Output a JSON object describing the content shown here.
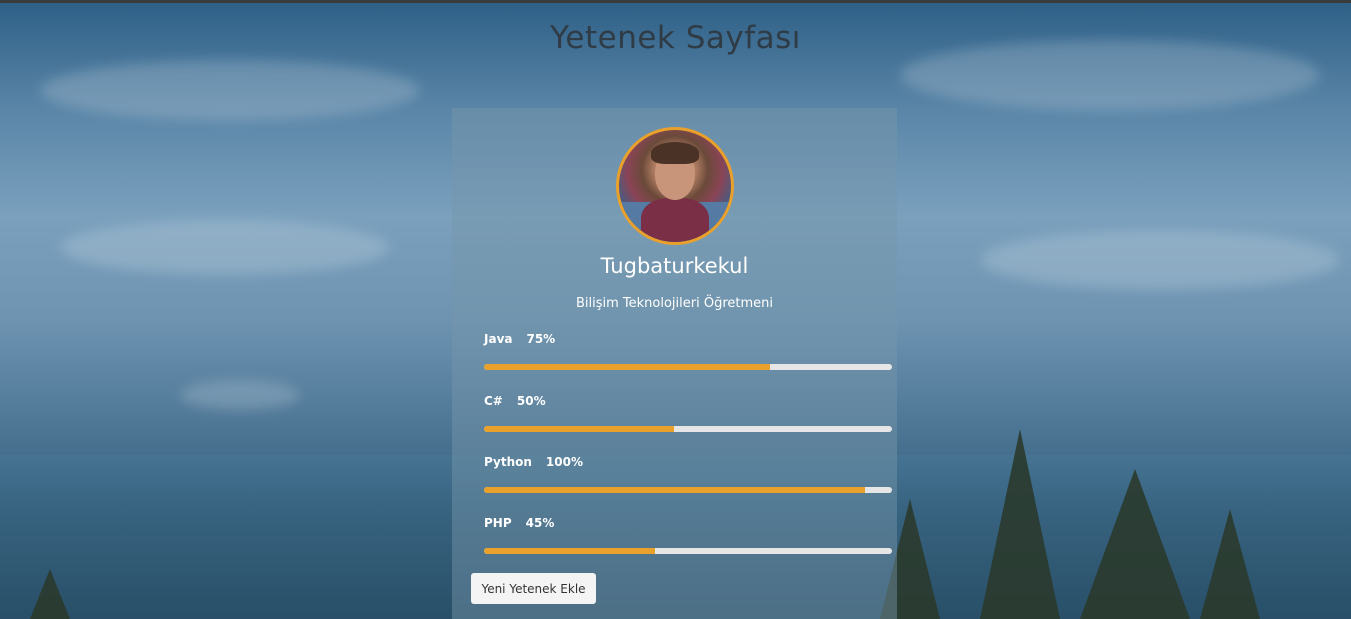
{
  "page": {
    "title": "Yetenek Sayfası"
  },
  "profile": {
    "name": "Tugbaturkekul",
    "subtitle": "Bilişim Teknolojileri Öğretmeni",
    "avatar_border_color": "#e9a12b"
  },
  "skills": [
    {
      "name": "Java",
      "percent_label": "75%",
      "fill_percent": 70
    },
    {
      "name": "C#",
      "percent_label": "50%",
      "fill_percent": 46.5
    },
    {
      "name": "Python",
      "percent_label": "100%",
      "fill_percent": 93.5
    },
    {
      "name": "PHP",
      "percent_label": "45%",
      "fill_percent": 42
    }
  ],
  "actions": {
    "add_skill_label": "Yeni Yetenek Ekle"
  },
  "colors": {
    "accent": "#e9a12b",
    "track": "#e6e6e6",
    "title_text": "#2f3b45"
  }
}
